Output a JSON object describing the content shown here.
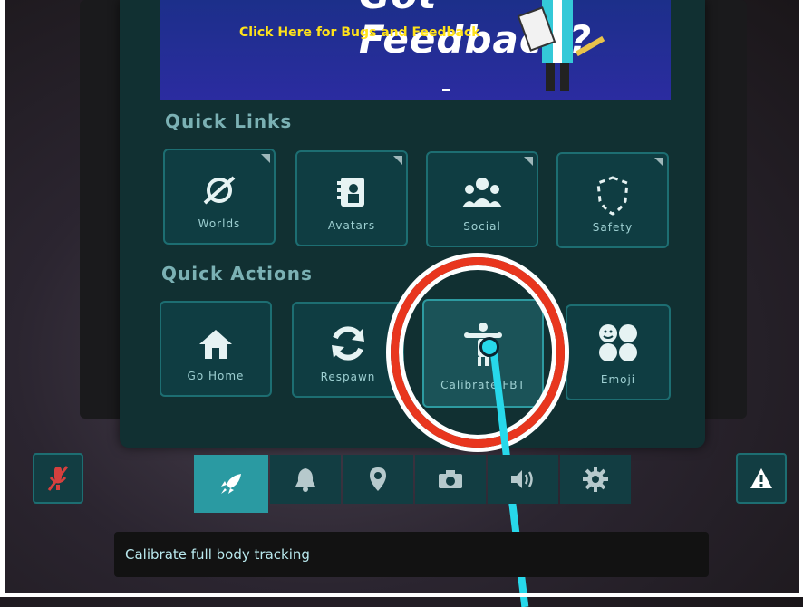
{
  "banner": {
    "title": "Got Feedback?",
    "subtitle": "Click Here for Bugs and Feedback"
  },
  "quick_links": {
    "title": "Quick Links",
    "items": [
      {
        "label": "Worlds",
        "icon": "planet-icon"
      },
      {
        "label": "Avatars",
        "icon": "avatar-book-icon"
      },
      {
        "label": "Social",
        "icon": "people-icon"
      },
      {
        "label": "Safety",
        "icon": "shield-outline-icon"
      }
    ]
  },
  "quick_actions": {
    "title": "Quick Actions",
    "items": [
      {
        "label": "Go Home",
        "icon": "home-icon"
      },
      {
        "label": "Respawn",
        "icon": "respawn-icon"
      },
      {
        "label": "Calibrate FBT",
        "icon": "calibrate-body-icon"
      },
      {
        "label": "Emoji",
        "icon": "emoji-icon"
      }
    ]
  },
  "tabbar": {
    "tabs": [
      {
        "icon": "rocket-icon",
        "active": true
      },
      {
        "icon": "bell-icon"
      },
      {
        "icon": "location-pin-icon"
      },
      {
        "icon": "camera-icon"
      },
      {
        "icon": "speaker-icon"
      },
      {
        "icon": "gear-icon"
      }
    ]
  },
  "side_buttons": {
    "left": {
      "icon": "mic-muted-icon"
    },
    "right": {
      "icon": "warning-icon"
    }
  },
  "tooltip": {
    "text": "Calibrate full body tracking"
  },
  "colors": {
    "accent": "#2a9aa2",
    "laser": "#27d8ea",
    "highlight": "#e8361e",
    "muted_red": "#d6403e",
    "banner_text": "#ffe21a"
  }
}
